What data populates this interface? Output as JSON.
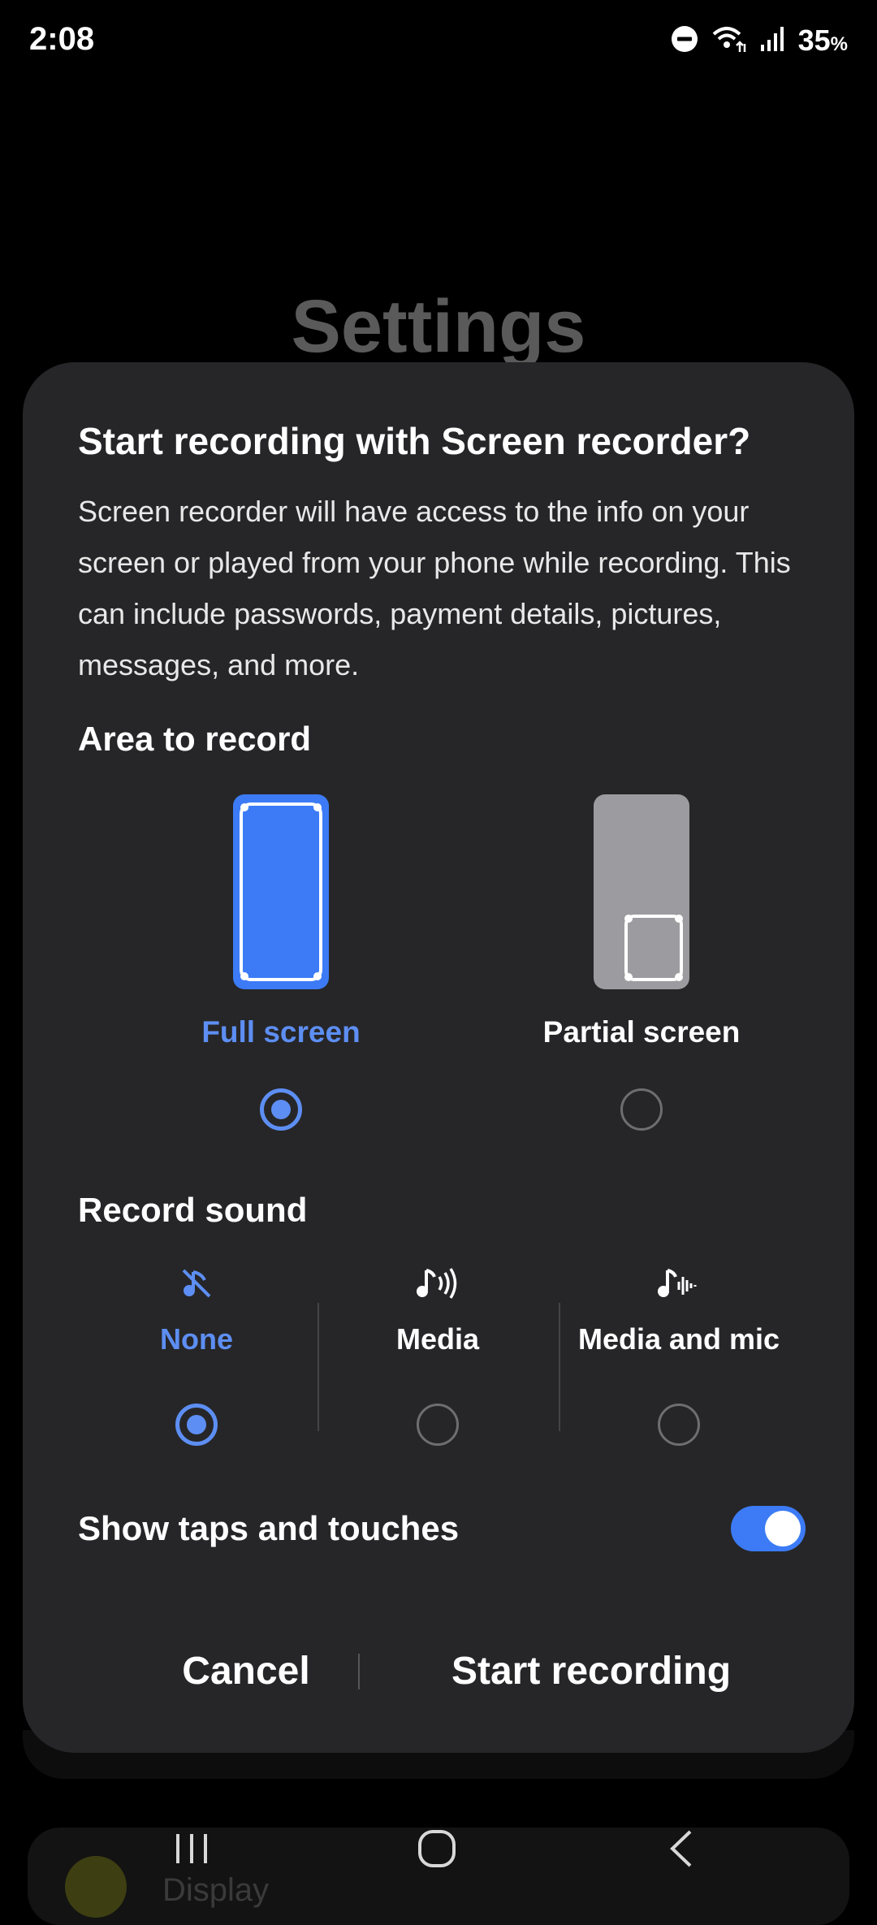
{
  "status_bar": {
    "time": "2:08",
    "battery": "35",
    "battery_unit": "%",
    "icons": [
      "dnd-icon",
      "wifi-icon",
      "signal-icon"
    ]
  },
  "background": {
    "title": "Settings",
    "partial_item_label": "Display"
  },
  "dialog": {
    "title": "Start recording with Screen recorder?",
    "body": "Screen recorder will have access to the info on your screen or played from your phone while recording. This can include passwords, payment details, pictures, messages, and more.",
    "area_section": {
      "label": "Area to record",
      "options": [
        {
          "label": "Full screen",
          "selected": true
        },
        {
          "label": "Partial screen",
          "selected": false
        }
      ]
    },
    "sound_section": {
      "label": "Record sound",
      "options": [
        {
          "label": "None",
          "icon": "sound-off-icon",
          "selected": true
        },
        {
          "label": "Media",
          "icon": "media-sound-icon",
          "selected": false
        },
        {
          "label": "Media and mic",
          "icon": "media-mic-icon",
          "selected": false
        }
      ]
    },
    "show_taps": {
      "label": "Show taps and touches",
      "enabled": true
    },
    "buttons": {
      "cancel": "Cancel",
      "start": "Start recording"
    }
  },
  "colors": {
    "accent": "#5d8ef3",
    "dialog_bg": "#262628",
    "selected_fill": "#3c7bf5"
  },
  "navbar": {
    "buttons": [
      "recent-apps-icon",
      "home-icon",
      "back-icon"
    ]
  }
}
